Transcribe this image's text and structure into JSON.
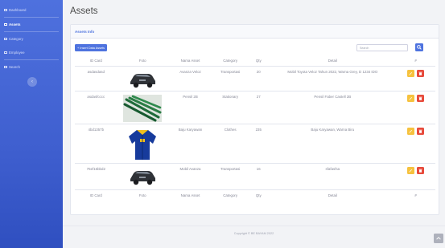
{
  "sidebar": {
    "items": [
      {
        "label": "Dashboard",
        "active": false
      },
      {
        "label": "Assets",
        "active": true
      },
      {
        "label": "Category",
        "active": false
      },
      {
        "label": "Employee",
        "active": false
      },
      {
        "label": "Search",
        "active": false
      }
    ],
    "toggle_glyph": "‹"
  },
  "page": {
    "title": "Assets"
  },
  "card": {
    "header": "Assets Info",
    "insert_label": "+ Insert Data Assets",
    "search_placeholder": "Search"
  },
  "table": {
    "columns": [
      "ID Card",
      "Foto",
      "Nama Asset",
      "Category",
      "Qty",
      "Detail",
      "#"
    ],
    "rows": [
      {
        "id": "asdasdasd",
        "image": "car",
        "name": "Avanza Veloz",
        "category": "Transportasi",
        "qty": "20",
        "detail": "Mobil Toyota Veloz Tahun 2022, Warna Grey, D 1234 IDO"
      },
      {
        "id": "asdasfcccc",
        "image": "pencils",
        "name": "Pensil 2B",
        "category": "Stationary",
        "qty": "27",
        "detail": "Pensil Faber Castell 2B"
      },
      {
        "id": "4bd1357b",
        "image": "jacket",
        "name": "Baju Karyawan",
        "category": "Clothes",
        "qty": "235",
        "detail": "Baju Karyawan, Warna Biru"
      },
      {
        "id": "75ef16bbd2",
        "image": "car",
        "name": "Mobil Avanza",
        "category": "Transportasi",
        "qty": "16",
        "detail": "sfafasfsa"
      }
    ]
  },
  "footer": {
    "text": "Copyright © BE BAYAM 2022"
  },
  "colors": {
    "primary": "#4e73df",
    "warning": "#f6c23e",
    "danger": "#e74a3b"
  }
}
